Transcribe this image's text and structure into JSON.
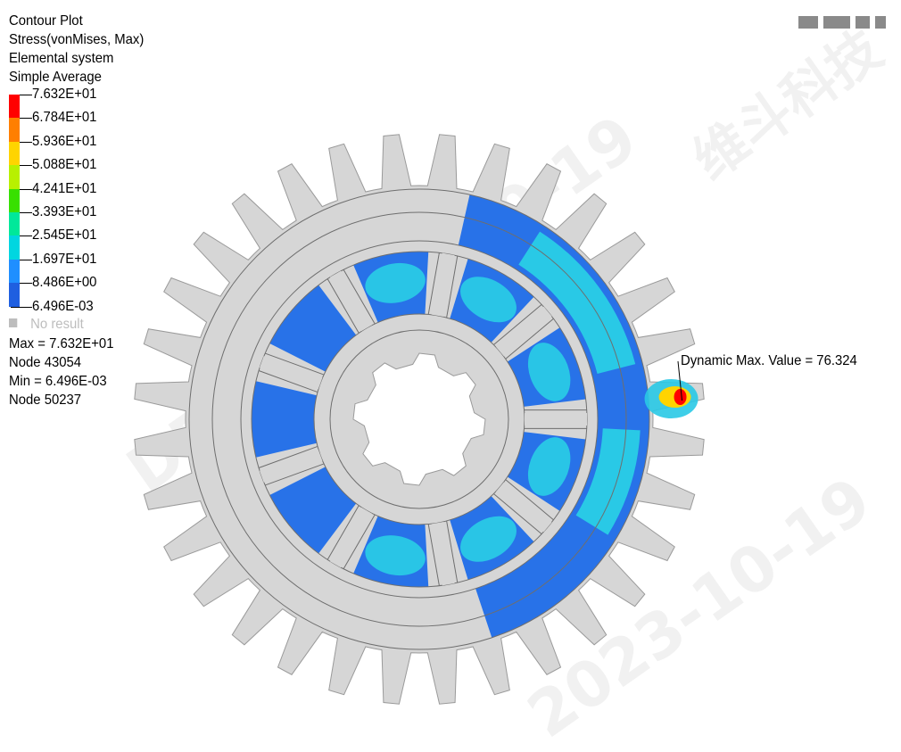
{
  "header": {
    "line1": "Contour Plot",
    "line2": "Stress(vonMises, Max)",
    "line3": "Elemental system",
    "line4": "Simple Average"
  },
  "legend": {
    "levels": [
      "7.632E+01",
      "6.784E+01",
      "5.936E+01",
      "5.088E+01",
      "4.241E+01",
      "3.393E+01",
      "2.545E+01",
      "1.697E+01",
      "8.486E+00",
      "6.496E-03"
    ],
    "colors": [
      "#ff0000",
      "#ff7f00",
      "#ffd400",
      "#b8f000",
      "#38e000",
      "#00e89a",
      "#00d6e0",
      "#1f8fff",
      "#1f5fe0"
    ],
    "no_result_label": "No result",
    "no_result_color": "#bdbdbd"
  },
  "info": {
    "max_line": "Max = 7.632E+01",
    "max_node": "Node 43054",
    "min_line": "Min = 6.496E-03",
    "min_node": "Node 50237"
  },
  "max_annotation": "Dynamic Max. Value =  76.324",
  "gear": {
    "teeth": 32,
    "base_color": "#d6d6d6",
    "stress_colors": {
      "low": "#2872e8",
      "mid": "#29c9e6",
      "high": "#ffd400",
      "peak": "#ff0000"
    }
  },
  "watermark": {
    "text1": "DFYE 2023-10-19",
    "text2": "2023-10-19",
    "text3": "维斗科技"
  }
}
